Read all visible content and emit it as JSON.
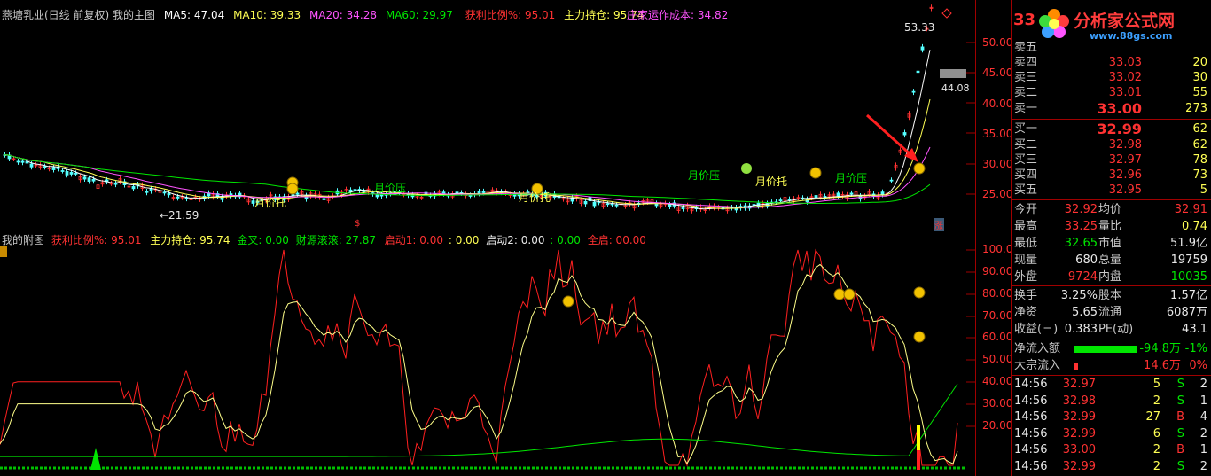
{
  "main": {
    "title": "燕塘乳业(日线 前复权) 我的主图",
    "ma5": "MA5: 47.04",
    "ma10": "MA10: 39.33",
    "ma20": "MA20: 34.28",
    "ma60": "MA60: 29.97",
    "profit_ratio": "获利比例%: 95.01",
    "main_holding": "主力持仓: 95.74",
    "cost": "庄家运作成本: 34.82",
    "high_label": "53.33",
    "low_label": "←21.59",
    "mid_label": "44.08",
    "zhang_badge": "涨",
    "dollar_mark": "$",
    "annotations": [
      "月价托",
      "月价压",
      "月价托",
      "月价压",
      "月价托",
      "月价压"
    ],
    "y_ticks": [
      "50.00",
      "45.00",
      "40.00",
      "35.00",
      "30.00",
      "25.00"
    ]
  },
  "sub": {
    "title": "我的附图",
    "profit_ratio": "获利比例%: 95.01",
    "main_holding": "主力持仓: 95.74",
    "golden_cross": "金叉: 0.00",
    "wealth": "财源滚滚: 27.87",
    "start1": "启动1: 0.00",
    "start1b": ": 0.00",
    "start2": "启动2: 0.00",
    "start2b": ": 0.00",
    "full_start": "全启: 00.00",
    "y_ticks": [
      "100.00",
      "90.00",
      "80.00",
      "70.00",
      "60.00",
      "50.00",
      "40.00",
      "30.00",
      "20.00"
    ]
  },
  "quote": {
    "price_header": "33",
    "logo_text": "分析家公式网",
    "logo_url": "www.88gs.com",
    "asks": [
      {
        "label": "卖五",
        "price": "",
        "vol": ""
      },
      {
        "label": "卖四",
        "price": "33.03",
        "vol": "20"
      },
      {
        "label": "卖三",
        "price": "33.02",
        "vol": "30"
      },
      {
        "label": "卖二",
        "price": "33.01",
        "vol": "55"
      },
      {
        "label": "卖一",
        "price": "33.00",
        "vol": "273"
      }
    ],
    "bids": [
      {
        "label": "买一",
        "price": "32.99",
        "vol": "62"
      },
      {
        "label": "买二",
        "price": "32.98",
        "vol": "62"
      },
      {
        "label": "买三",
        "price": "32.97",
        "vol": "78"
      },
      {
        "label": "买四",
        "price": "32.96",
        "vol": "73"
      },
      {
        "label": "买五",
        "price": "32.95",
        "vol": "5"
      }
    ],
    "stats": {
      "open_l": "今开",
      "open_v": "32.92",
      "avg_l": "均价",
      "avg_v": "32.91",
      "high_l": "最高",
      "high_v": "33.25",
      "vr_l": "量比",
      "vr_v": "0.74",
      "low_l": "最低",
      "low_v": "32.65",
      "mv_l": "市值",
      "mv_v": "51.9亿",
      "cur_l": "现量",
      "cur_v": "680",
      "tot_l": "总量",
      "tot_v": "19759",
      "out_l": "外盘",
      "out_v": "9724",
      "in_l": "内盘",
      "in_v": "10035",
      "turn_l": "换手",
      "turn_v": "3.25%",
      "cap_l": "股本",
      "cap_v": "1.57亿",
      "na_l": "净资",
      "na_v": "5.65",
      "float_l": "流通",
      "float_v": "6087万",
      "eps_l": "收益(三)",
      "eps_v": "0.383",
      "pe_l": "PE(动)",
      "pe_v": "43.1"
    },
    "flow": {
      "net_l": "净流入额",
      "net_v": "-94.8万",
      "net_p": "-1%",
      "big_l": "大宗流入",
      "big_v": "14.6万",
      "big_p": "0%"
    },
    "ticks": [
      {
        "t": "14:56",
        "p": "32.97",
        "v": "5",
        "s": "S",
        "n": "2"
      },
      {
        "t": "14:56",
        "p": "32.98",
        "v": "2",
        "s": "S",
        "n": "1"
      },
      {
        "t": "14:56",
        "p": "32.99",
        "v": "27",
        "s": "B",
        "n": "4"
      },
      {
        "t": "14:56",
        "p": "32.99",
        "v": "6",
        "s": "S",
        "n": "2"
      },
      {
        "t": "14:56",
        "p": "33.00",
        "v": "2",
        "s": "B",
        "n": "1"
      },
      {
        "t": "14:56",
        "p": "32.99",
        "v": "2",
        "s": "S",
        "n": "2"
      }
    ]
  },
  "colors": {
    "up": "#ff3232",
    "down": "#54ffff",
    "ma5": "#ffffff",
    "ma10": "#ffff54",
    "ma20": "#ff54ff",
    "ma60": "#00e600",
    "border": "#a00000"
  }
}
